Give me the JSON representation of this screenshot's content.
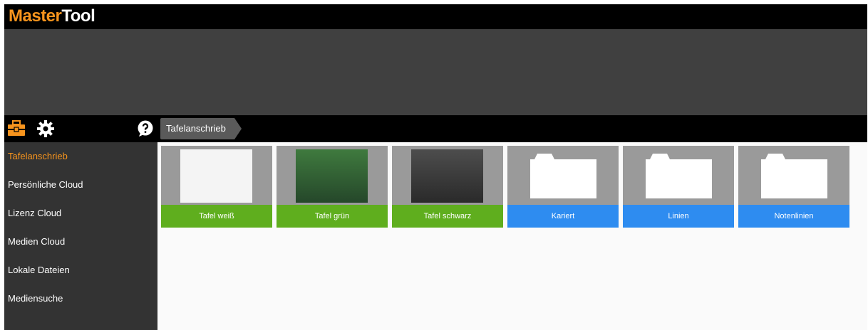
{
  "app": {
    "logo_part1": "Master",
    "logo_part2": "Tool",
    "accent_color": "#f7941d"
  },
  "toolbar": {
    "icons": [
      "briefcase-icon",
      "gear-icon",
      "help-icon"
    ],
    "breadcrumb": "Tafelanschrieb"
  },
  "sidebar": {
    "items": [
      {
        "label": "Tafelanschrieb",
        "active": true
      },
      {
        "label": "Persönliche Cloud"
      },
      {
        "label": "Lizenz Cloud"
      },
      {
        "label": "Medien Cloud"
      },
      {
        "label": "Lokale Dateien"
      },
      {
        "label": "Mediensuche"
      }
    ]
  },
  "tiles": [
    {
      "label": "Tafel weiß",
      "kind": "board",
      "color": "#5fae1e"
    },
    {
      "label": "Tafel grün",
      "kind": "board",
      "color": "#5fae1e"
    },
    {
      "label": "Tafel schwarz",
      "kind": "board",
      "color": "#5fae1e"
    },
    {
      "label": "Kariert",
      "kind": "folder",
      "color": "#2e8cf0"
    },
    {
      "label": "Linien",
      "kind": "folder",
      "color": "#2e8cf0"
    },
    {
      "label": "Notenlinien",
      "kind": "folder",
      "color": "#2e8cf0"
    }
  ]
}
